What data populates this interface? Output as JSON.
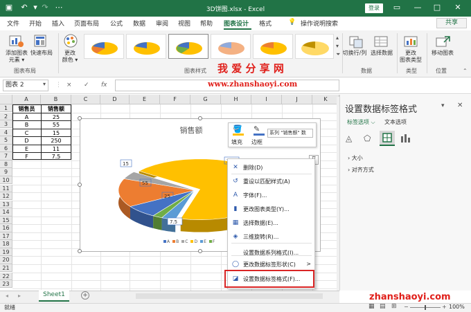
{
  "title_bar": {
    "title": "3D饼图.xlsx  -  Excel",
    "login": "登录",
    "qat_icons": [
      "save-icon",
      "undo-icon",
      "redo-icon",
      "customize-icon"
    ],
    "window_icons": [
      "ribbon-display-icon",
      "minimize-icon",
      "maximize-icon",
      "close-icon"
    ]
  },
  "menu": {
    "items": [
      "文件",
      "开始",
      "插入",
      "页面布局",
      "公式",
      "数据",
      "审阅",
      "视图",
      "帮助",
      "图表设计",
      "格式"
    ],
    "active": "图表设计",
    "tell_me": "操作说明搜索",
    "share": "共享"
  },
  "ribbon": {
    "add_element": [
      "添加图表",
      "元素 ▾"
    ],
    "quick_layout": "快速布局",
    "change_colors": [
      "更改",
      "颜色 ▾"
    ],
    "group_layout": "图表布局",
    "group_styles": "图表样式",
    "switch_row_col": "切换行/列",
    "select_data": "选择数据",
    "group_data": "数据",
    "change_type": [
      "更改",
      "图表类型"
    ],
    "group_type": "类型",
    "move_chart": "移动图表",
    "group_location": "位置"
  },
  "watermark": {
    "title": "我 爱 分 享 网",
    "url": "www.zhanshaoyi.com",
    "url_bottom": "zhanshaoyi.com"
  },
  "formula_bar": {
    "name_box": "图表 2",
    "cancel": "×",
    "enter": "✓",
    "fx": "fx",
    "value": ""
  },
  "sheet": {
    "columns": [
      "A",
      "B",
      "C",
      "D",
      "E",
      "F",
      "G",
      "H",
      "I",
      "J",
      "K"
    ],
    "rows": [
      "1",
      "2",
      "3",
      "4",
      "5",
      "6",
      "7",
      "8",
      "9",
      "10",
      "11",
      "12",
      "13",
      "14",
      "15",
      "16",
      "17",
      "18",
      "19",
      "20",
      "21",
      "22",
      "23"
    ],
    "table_header": [
      "销售员",
      "销售额"
    ],
    "table_rows": [
      [
        "A",
        "25"
      ],
      [
        "B",
        "55"
      ],
      [
        "C",
        "15"
      ],
      [
        "D",
        "250"
      ],
      [
        "E",
        "11"
      ],
      [
        "F",
        "7.5"
      ]
    ]
  },
  "chart": {
    "title": "销售额",
    "data_labels": [
      "15",
      "55",
      "25",
      "250",
      "7.5"
    ],
    "legend": [
      "A",
      "B",
      "C",
      "D",
      "E",
      "F"
    ]
  },
  "chart_data": {
    "type": "pie",
    "title": "销售额",
    "categories": [
      "A",
      "B",
      "C",
      "D",
      "E",
      "F"
    ],
    "values": [
      25,
      55,
      15,
      250,
      11,
      7.5
    ],
    "colors": [
      "#4472c4",
      "#ed7d31",
      "#a5a5a5",
      "#ffc000",
      "#5b9bd5",
      "#70ad47"
    ],
    "legend_position": "bottom"
  },
  "mini_toolbar": {
    "fill": "填充",
    "outline": "边框",
    "series_dropdown": "系列 \"销售额\" 数"
  },
  "context_menu": {
    "items": [
      {
        "icon": "✕",
        "label": "删除(D)"
      },
      {
        "icon": "↺",
        "label": "重设以匹配样式(A)"
      },
      {
        "icon": "A",
        "label": "字体(F)..."
      },
      {
        "icon": "▮",
        "label": "更改图表类型(Y)..."
      },
      {
        "icon": "▦",
        "label": "选择数据(E)..."
      },
      {
        "icon": "◈",
        "label": "三维旋转(R)..."
      },
      {
        "icon": "",
        "label": "设置数据系列格式(I)..."
      },
      {
        "icon": "◯",
        "label": "更改数据标签形状(C)"
      },
      {
        "icon": "◪",
        "label": "设置数据标签格式(F)..."
      }
    ],
    "submenu_arrow": ">"
  },
  "format_pane": {
    "title": "设置数据标签格式",
    "tab_label_options": "标签选项",
    "tab_text_options": "文本选项",
    "sections": [
      "大小",
      "对齐方式"
    ]
  },
  "tabs": {
    "sheet": "Sheet1",
    "add": "+"
  },
  "status": {
    "ready": "就绪",
    "zoom": "100%"
  },
  "colors": {
    "excel_green": "#217346",
    "highlight_red": "#d92424",
    "watermark_red": "#e0201b"
  }
}
